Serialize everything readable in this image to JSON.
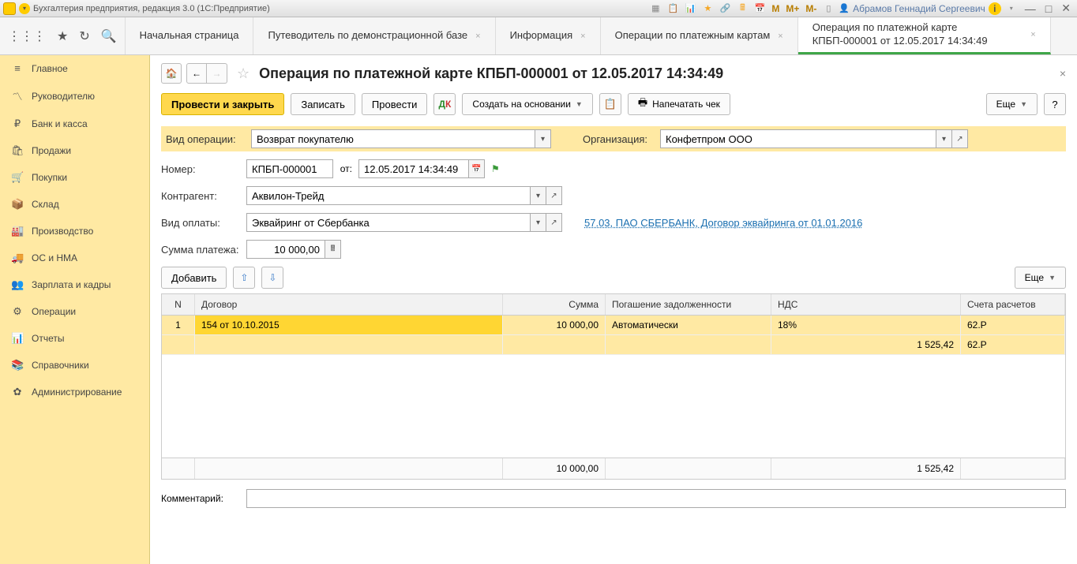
{
  "titlebar": {
    "app_title": "Бухгалтерия предприятия, редакция 3.0  (1С:Предприятие)",
    "user": "Абрамов Геннадий Сергеевич",
    "m": "M",
    "m_plus": "M+",
    "m_minus": "M-"
  },
  "tabs": [
    {
      "label": "Начальная страница",
      "closable": false
    },
    {
      "label": "Путеводитель по демонстрационной базе",
      "closable": true
    },
    {
      "label": "Информация",
      "closable": true
    },
    {
      "label": "Операции по платежным картам",
      "closable": true
    },
    {
      "label": "Операция по платежной карте КПБП-000001 от 12.05.2017 14:34:49",
      "closable": true,
      "active": true
    }
  ],
  "sidebar": [
    {
      "icon": "≡",
      "label": "Главное"
    },
    {
      "icon": "📈",
      "label": "Руководителю"
    },
    {
      "icon": "₽",
      "label": "Банк и касса"
    },
    {
      "icon": "🛍",
      "label": "Продажи"
    },
    {
      "icon": "🛒",
      "label": "Покупки"
    },
    {
      "icon": "📦",
      "label": "Склад"
    },
    {
      "icon": "🏭",
      "label": "Производство"
    },
    {
      "icon": "🚚",
      "label": "ОС и НМА"
    },
    {
      "icon": "👥",
      "label": "Зарплата и кадры"
    },
    {
      "icon": "⚙",
      "label": "Операции"
    },
    {
      "icon": "📊",
      "label": "Отчеты"
    },
    {
      "icon": "📚",
      "label": "Справочники"
    },
    {
      "icon": "✿",
      "label": "Администрирование"
    }
  ],
  "page": {
    "title": "Операция по платежной карте КПБП-000001 от 12.05.2017 14:34:49"
  },
  "toolbar": {
    "post_close": "Провести и закрыть",
    "save": "Записать",
    "post": "Провести",
    "create_based": "Создать на основании",
    "print_check": "Напечатать чек",
    "more": "Еще",
    "help": "?"
  },
  "form": {
    "op_type_label": "Вид операции:",
    "op_type_value": "Возврат покупателю",
    "org_label": "Организация:",
    "org_value": "Конфетпром ООО",
    "number_label": "Номер:",
    "number_value": "КПБП-000001",
    "date_label": "от:",
    "date_value": "12.05.2017 14:34:49",
    "counterparty_label": "Контрагент:",
    "counterparty_value": "Аквилон-Трейд",
    "payment_type_label": "Вид оплаты:",
    "payment_type_value": "Эквайринг от Сбербанка",
    "payment_link": "57.03, ПАО СБЕРБАНК, Договор эквайринга от 01.01.2016",
    "amount_label": "Сумма платежа:",
    "amount_value": "10 000,00",
    "add_btn": "Добавить",
    "comment_label": "Комментарий:",
    "comment_value": ""
  },
  "grid": {
    "headers": {
      "n": "N",
      "contract": "Договор",
      "sum": "Сумма",
      "pay": "Погашение задолженности",
      "vat": "НДС",
      "acc": "Счета расчетов"
    },
    "rows": [
      {
        "n": "1",
        "contract": "154 от 10.10.2015",
        "sum": "10 000,00",
        "pay": "Автоматически",
        "vat": "18%",
        "acc": "62.Р",
        "sub_vat": "1 525,42",
        "sub_acc": "62.Р"
      }
    ],
    "footer": {
      "sum": "10 000,00",
      "vat": "1 525,42"
    }
  }
}
